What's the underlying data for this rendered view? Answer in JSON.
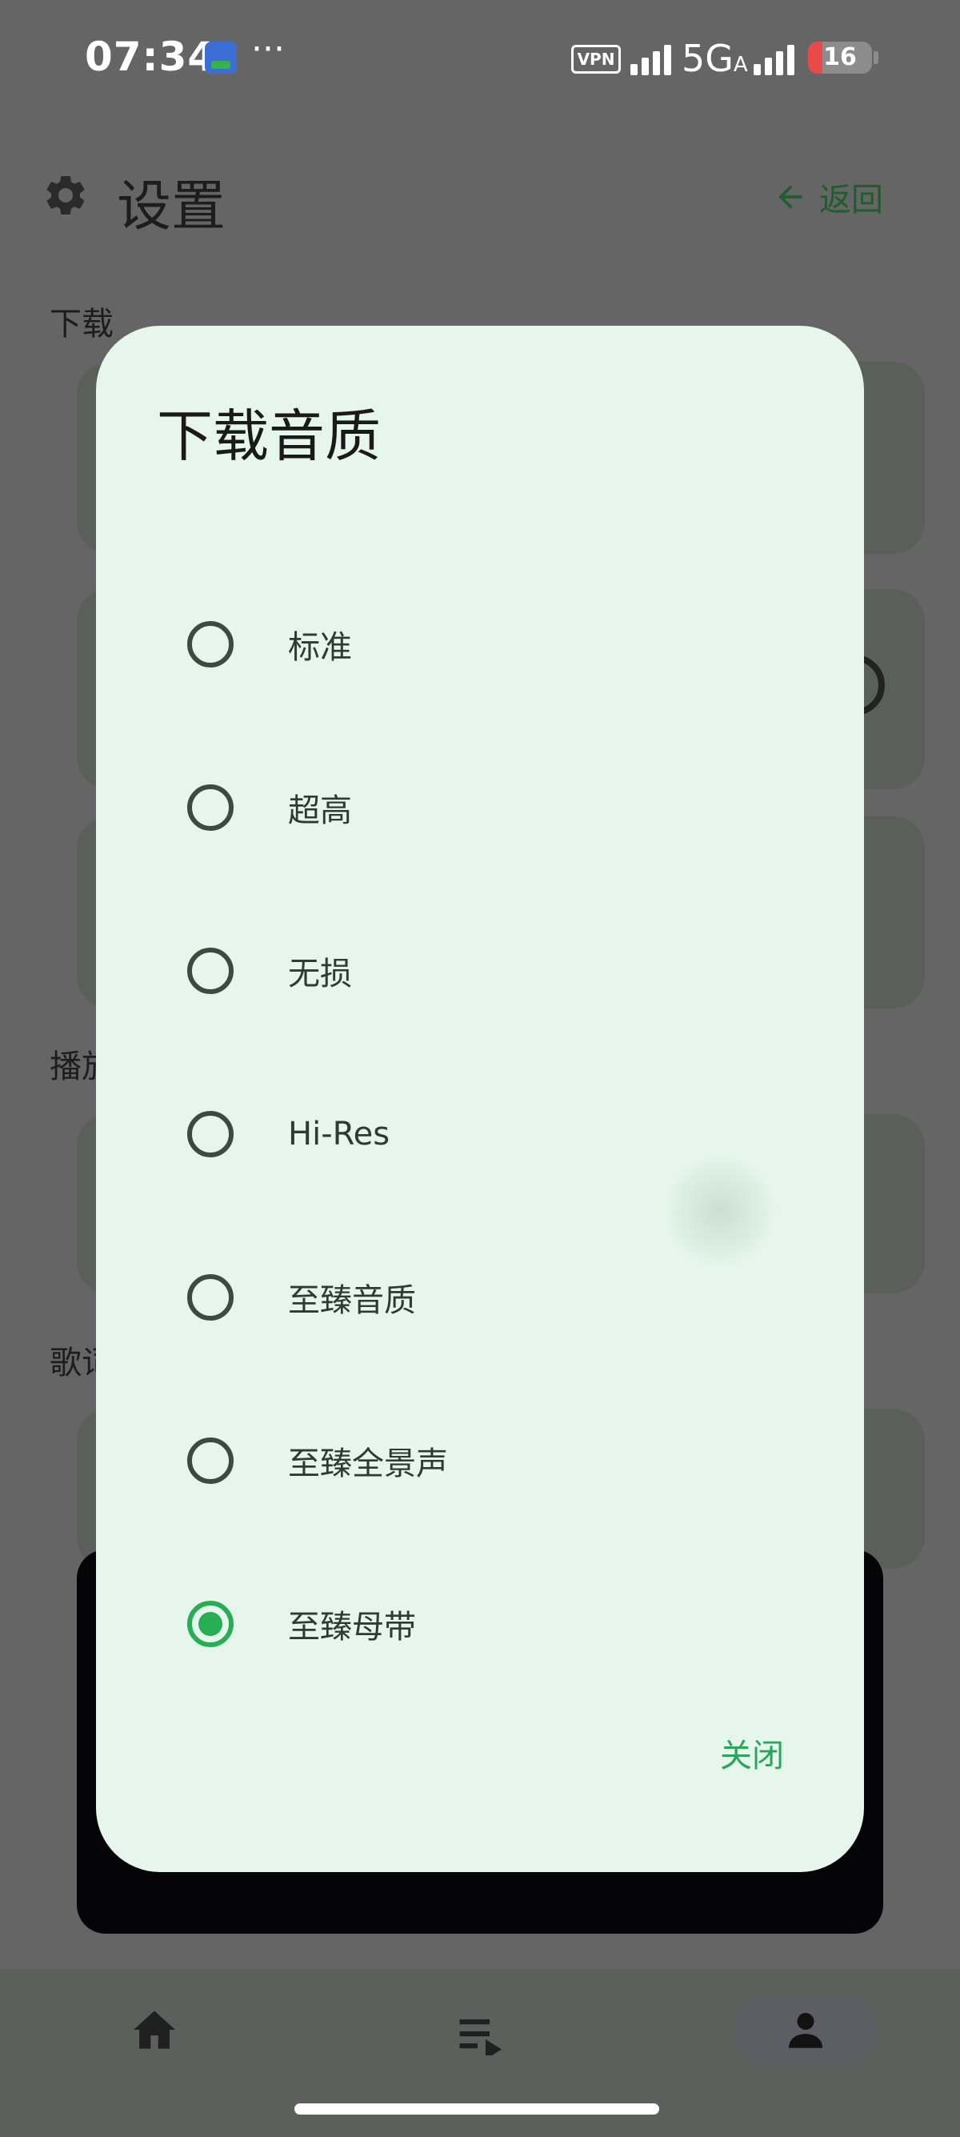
{
  "status_bar": {
    "time": "07:34",
    "more": "···",
    "vpn": "VPN",
    "network": "5G",
    "network_sub": "A",
    "battery": "16"
  },
  "header": {
    "title": "设置",
    "back_label": "返回"
  },
  "background": {
    "section_download": "下载",
    "section_playback": "播放",
    "section_lyrics": "歌词"
  },
  "dialog": {
    "title": "下载音质",
    "options": [
      {
        "label": "标准",
        "selected": false
      },
      {
        "label": "超高",
        "selected": false
      },
      {
        "label": "无损",
        "selected": false
      },
      {
        "label": "Hi-Res",
        "selected": false
      },
      {
        "label": "至臻音质",
        "selected": false
      },
      {
        "label": "至臻全景声",
        "selected": false
      },
      {
        "label": "至臻母带",
        "selected": true
      }
    ],
    "close_label": "关闭"
  },
  "colors": {
    "accent": "#27ae55",
    "dialog_bg": "#e6f6ec",
    "scrim": "#646564"
  },
  "icons": [
    "gear-icon",
    "arrow-left-icon",
    "home-icon",
    "playlist-icon",
    "person-icon"
  ]
}
